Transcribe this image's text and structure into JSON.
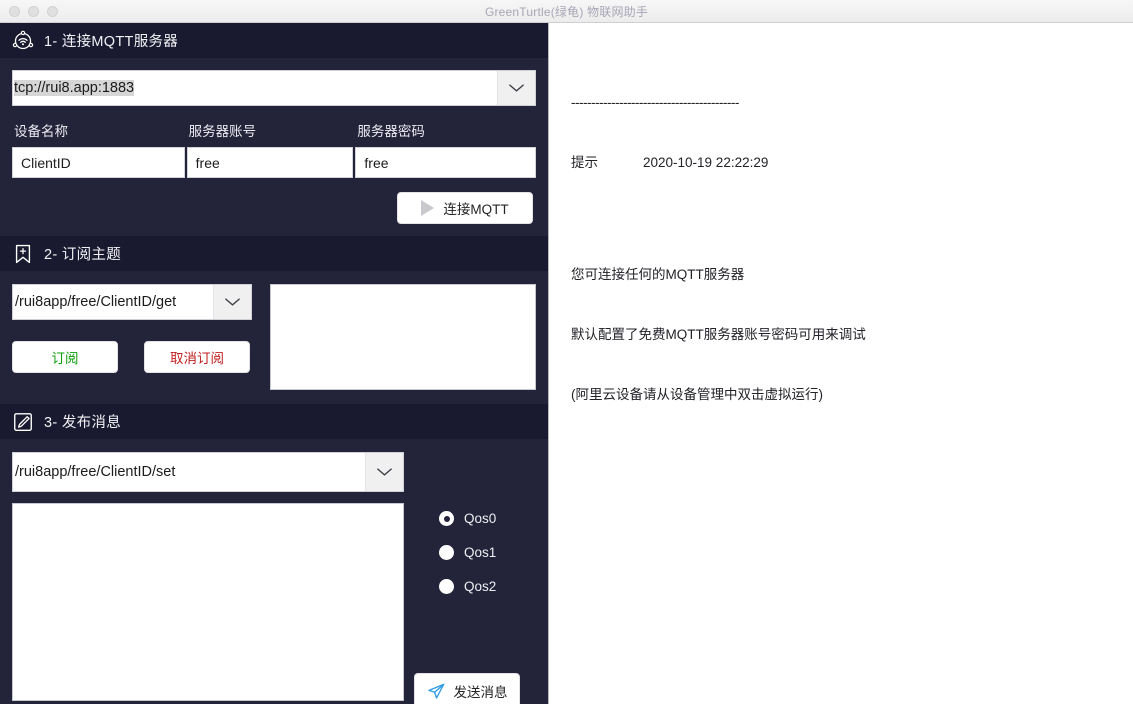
{
  "window": {
    "title": "GreenTurtle(绿龟) 物联网助手",
    "traffic_lights": [
      "close",
      "minimize",
      "zoom"
    ]
  },
  "sections": {
    "connect": {
      "icon": "iot-wifi-icon",
      "title": "1- 连接MQTT服务器",
      "broker_combo": {
        "value": "tcp://rui8.app:1883",
        "icon": "chevron-down-icon"
      },
      "fields": [
        {
          "label": "设备名称",
          "value": "ClientID"
        },
        {
          "label": "服务器账号",
          "value": "free"
        },
        {
          "label": "服务器密码",
          "value": "free"
        }
      ],
      "connect_button": {
        "label": "连接MQTT",
        "icon": "play-icon"
      }
    },
    "subscribe": {
      "icon": "bookmark-plus-icon",
      "title": "2- 订阅主题",
      "topic_combo": {
        "value": "/rui8app/free/ClientID/get",
        "icon": "chevron-down-icon"
      },
      "subscribe_button": {
        "label": "订阅",
        "color": "#0aa00a"
      },
      "unsubscribe_button": {
        "label": "取消订阅",
        "color": "#c22020"
      },
      "messages": ""
    },
    "publish": {
      "icon": "edit-square-icon",
      "title": "3- 发布消息",
      "topic_combo": {
        "value": "/rui8app/free/ClientID/set",
        "icon": "chevron-down-icon"
      },
      "payload": "",
      "qos_options": [
        {
          "label": "Qos0",
          "selected": true
        },
        {
          "label": "Qos1",
          "selected": false
        },
        {
          "label": "Qos2",
          "selected": false
        }
      ],
      "send_button": {
        "label": "发送消息",
        "icon": "paper-plane-icon"
      }
    }
  },
  "log": {
    "divider": "------------------------------------------",
    "tag": "提示",
    "timestamp": "2020-10-19 22:22:29",
    "lines": [
      "您可连接任何的MQTT服务器",
      "默认配置了免费MQTT服务器账号密码可用来调试",
      "(阿里云设备请从设备管理中双击虚拟运行)"
    ]
  },
  "colors": {
    "panel_bg": "#232339",
    "section_header_bg": "#191930",
    "accent_green": "#0aa00a",
    "accent_red": "#c22020",
    "accent_blue": "#2f9ce8"
  }
}
